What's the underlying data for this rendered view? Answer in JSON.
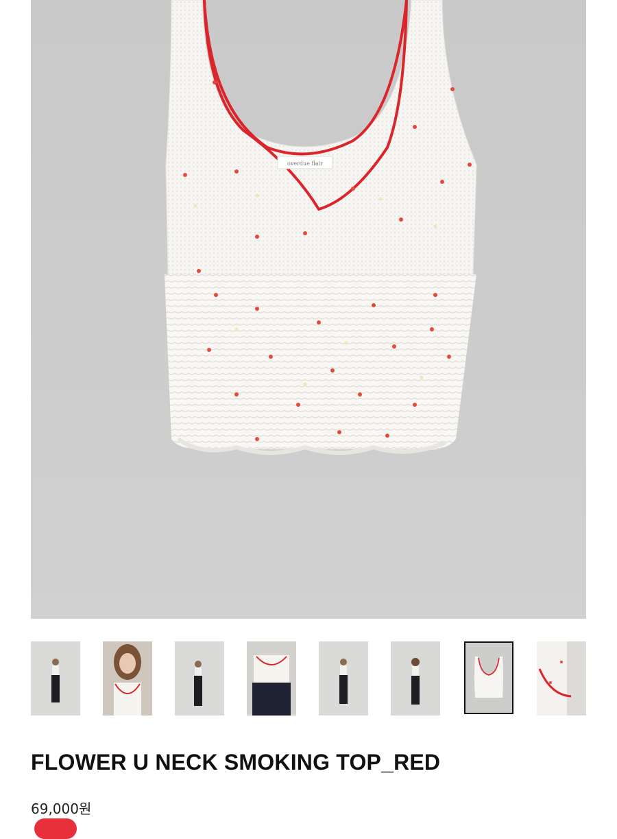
{
  "product": {
    "hero_image": "flower-u-neck-smoking-top-front",
    "label_text": "overdue flair",
    "title": "FLOWER U NECK SMOKING TOP_RED",
    "price": "69,000원"
  },
  "thumbnails": [
    {
      "name": "full-body-front"
    },
    {
      "name": "close-up-portrait"
    },
    {
      "name": "full-body-side"
    },
    {
      "name": "top-detail-front"
    },
    {
      "name": "full-body-back"
    },
    {
      "name": "full-body-back-2"
    },
    {
      "name": "product-flat-lay",
      "selected": true
    },
    {
      "name": "strap-detail"
    }
  ],
  "colors": {
    "accent_red": "#d9252b",
    "background_gray": "#cbcbcb",
    "garment_white": "#f6f5f2"
  }
}
